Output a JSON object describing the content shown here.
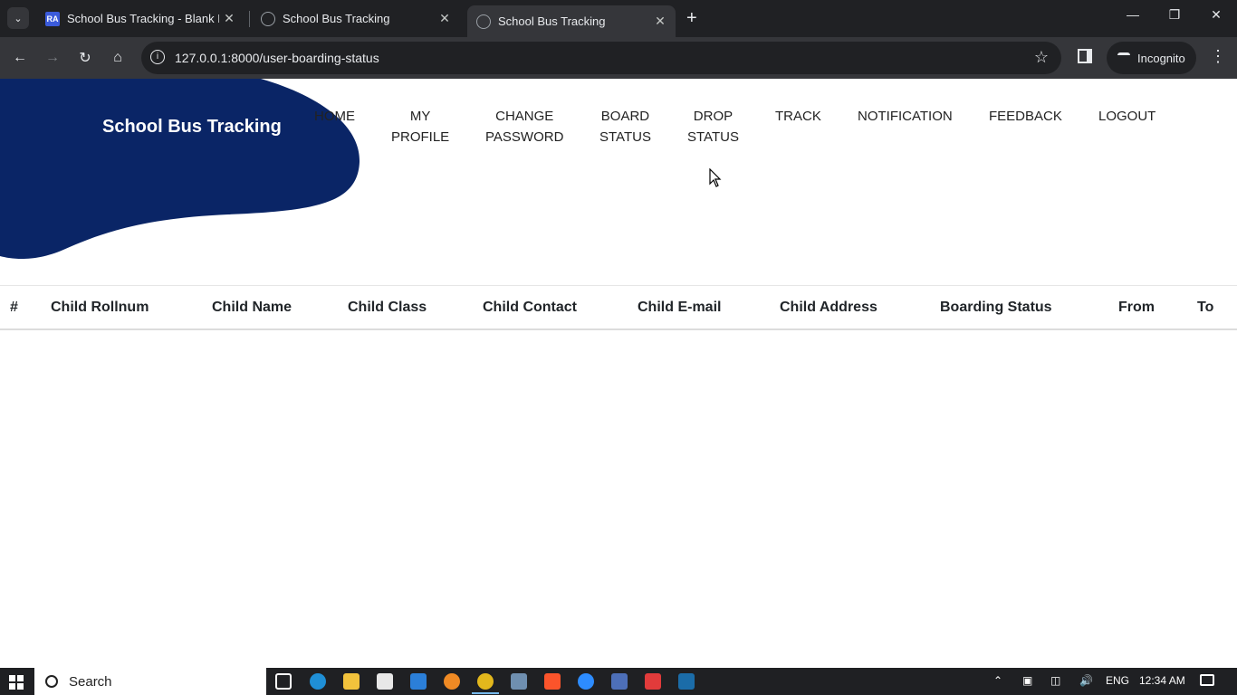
{
  "browser": {
    "tabs": [
      {
        "title": "School Bus Tracking - Blank Pa",
        "favicon": "RA",
        "active": false
      },
      {
        "title": "School Bus Tracking",
        "favicon": "globe-icon",
        "active": false
      },
      {
        "title": "School Bus Tracking",
        "favicon": "globe-icon",
        "active": true
      }
    ],
    "url": "127.0.0.1:8000/user-boarding-status",
    "incognito_label": "Incognito"
  },
  "site": {
    "brand": "School Bus Tracking",
    "brand_color": "#0a2566",
    "nav": [
      {
        "label": "HOME"
      },
      {
        "label": "MY\nPROFILE"
      },
      {
        "label": "CHANGE\nPASSWORD"
      },
      {
        "label": "BOARD\nSTATUS"
      },
      {
        "label": "DROP\nSTATUS"
      },
      {
        "label": "TRACK"
      },
      {
        "label": "NOTIFICATION"
      },
      {
        "label": "FEEDBACK"
      },
      {
        "label": "LOGOUT"
      }
    ]
  },
  "table": {
    "headers": [
      "#",
      "Child Rollnum",
      "Child Name",
      "Child Class",
      "Child Contact",
      "Child E-mail",
      "Child Address",
      "Boarding Status",
      "From",
      "To"
    ],
    "rows": []
  },
  "taskbar": {
    "search_label": "Search",
    "language": "ENG",
    "time": "12:34 AM"
  }
}
